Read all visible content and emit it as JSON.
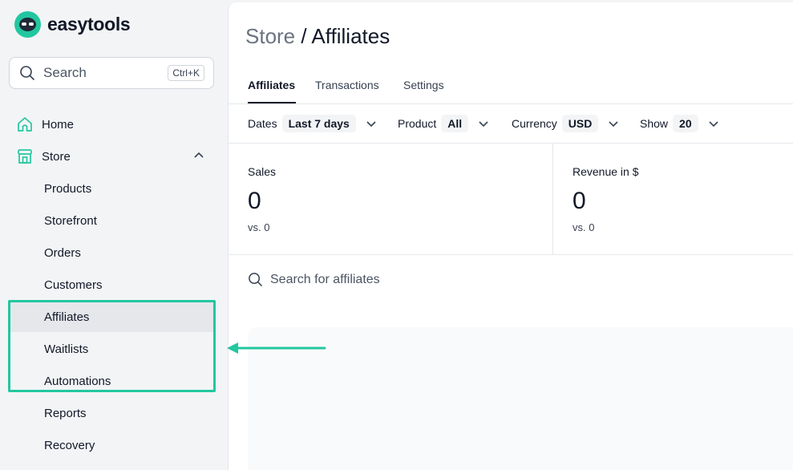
{
  "brand": {
    "name": "easytools"
  },
  "search": {
    "placeholder": "Search",
    "shortcut": "Ctrl+K"
  },
  "nav": {
    "home": "Home",
    "store": "Store",
    "store_items": [
      "Products",
      "Storefront",
      "Orders",
      "Customers",
      "Affiliates",
      "Waitlists",
      "Automations",
      "Reports",
      "Recovery"
    ],
    "active_item": "Affiliates"
  },
  "page": {
    "breadcrumb_parent": "Store",
    "separator": "/",
    "title": "Affiliates"
  },
  "tabs": [
    "Affiliates",
    "Transactions",
    "Settings"
  ],
  "filters": [
    {
      "label": "Dates",
      "value": "Last 7 days"
    },
    {
      "label": "Product",
      "value": "All"
    },
    {
      "label": "Currency",
      "value": "USD"
    },
    {
      "label": "Show",
      "value": "20"
    }
  ],
  "stats": [
    {
      "label": "Sales",
      "value": "0",
      "comparison": "vs. 0"
    },
    {
      "label": "Revenue in $",
      "value": "0",
      "comparison": "vs. 0"
    }
  ],
  "affiliate_search": {
    "placeholder": "Search for affiliates"
  },
  "colors": {
    "accent": "#22c7a0",
    "sidebar_bg": "#f3f4f6",
    "active_item_bg": "#e5e7eb"
  },
  "icons": [
    "search-icon",
    "home-icon",
    "store-icon",
    "chevron-up-icon",
    "chevron-down-icon",
    "arrow-left-icon"
  ]
}
